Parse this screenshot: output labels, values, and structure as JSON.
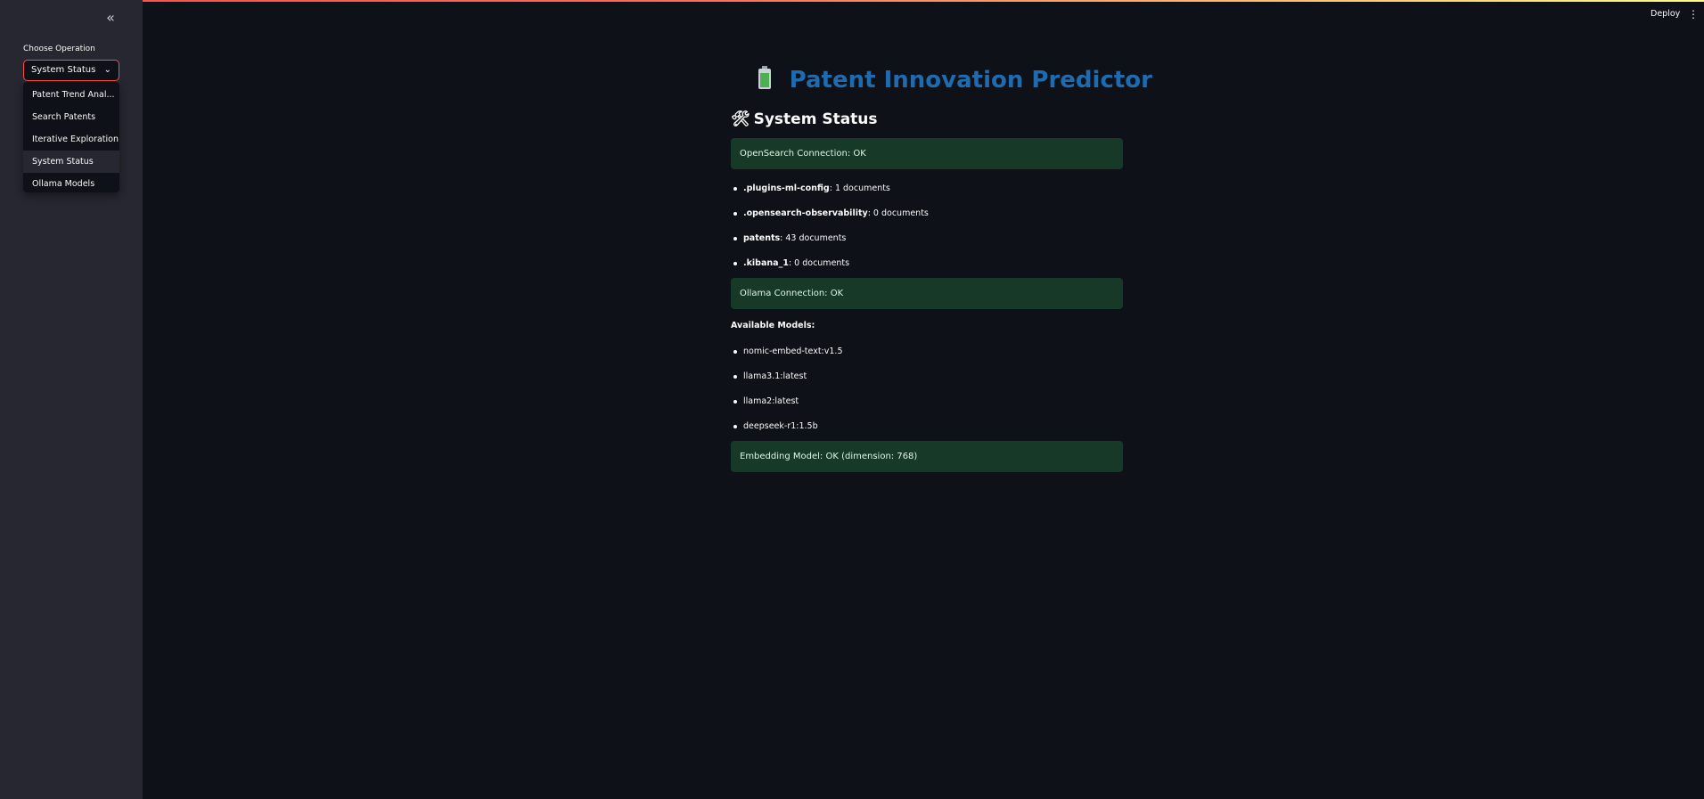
{
  "sidebar": {
    "collapse_icon": "double-chevron-left-icon",
    "label": "Choose Operation",
    "selected": "System Status",
    "options": [
      "Patent Trend Anal...",
      "Search Patents",
      "Iterative Exploration",
      "System Status",
      "Ollama Models"
    ],
    "active_index": 3
  },
  "header": {
    "deploy_label": "Deploy",
    "menu_icon": "kebab-menu-icon"
  },
  "main": {
    "title_icon": "battery-icon",
    "title": "Patent Innovation Predictor",
    "section_icon": "tools-icon",
    "section_title": "System Status",
    "opensearch_status": "OpenSearch Connection: OK",
    "indices": [
      {
        "name": ".plugins-ml-config",
        "count": ": 1 documents"
      },
      {
        "name": ".opensearch-observability",
        "count": ": 0 documents"
      },
      {
        "name": "patents",
        "count": ": 43 documents"
      },
      {
        "name": ".kibana_1",
        "count": ": 0 documents"
      }
    ],
    "ollama_status": "Ollama Connection: OK",
    "models_label": "Available Models:",
    "models": [
      "nomic-embed-text:v1.5",
      "llama3.1:latest",
      "llama2:latest",
      "deepseek-r1:1.5b"
    ],
    "embedding_status": "Embedding Model: OK (dimension: 768)"
  },
  "colors": {
    "accent": "#ff4b4b",
    "title": "#1f6bb0",
    "success_bg": "#173928",
    "sidebar_bg": "#262730",
    "main_bg": "#0e1117"
  }
}
